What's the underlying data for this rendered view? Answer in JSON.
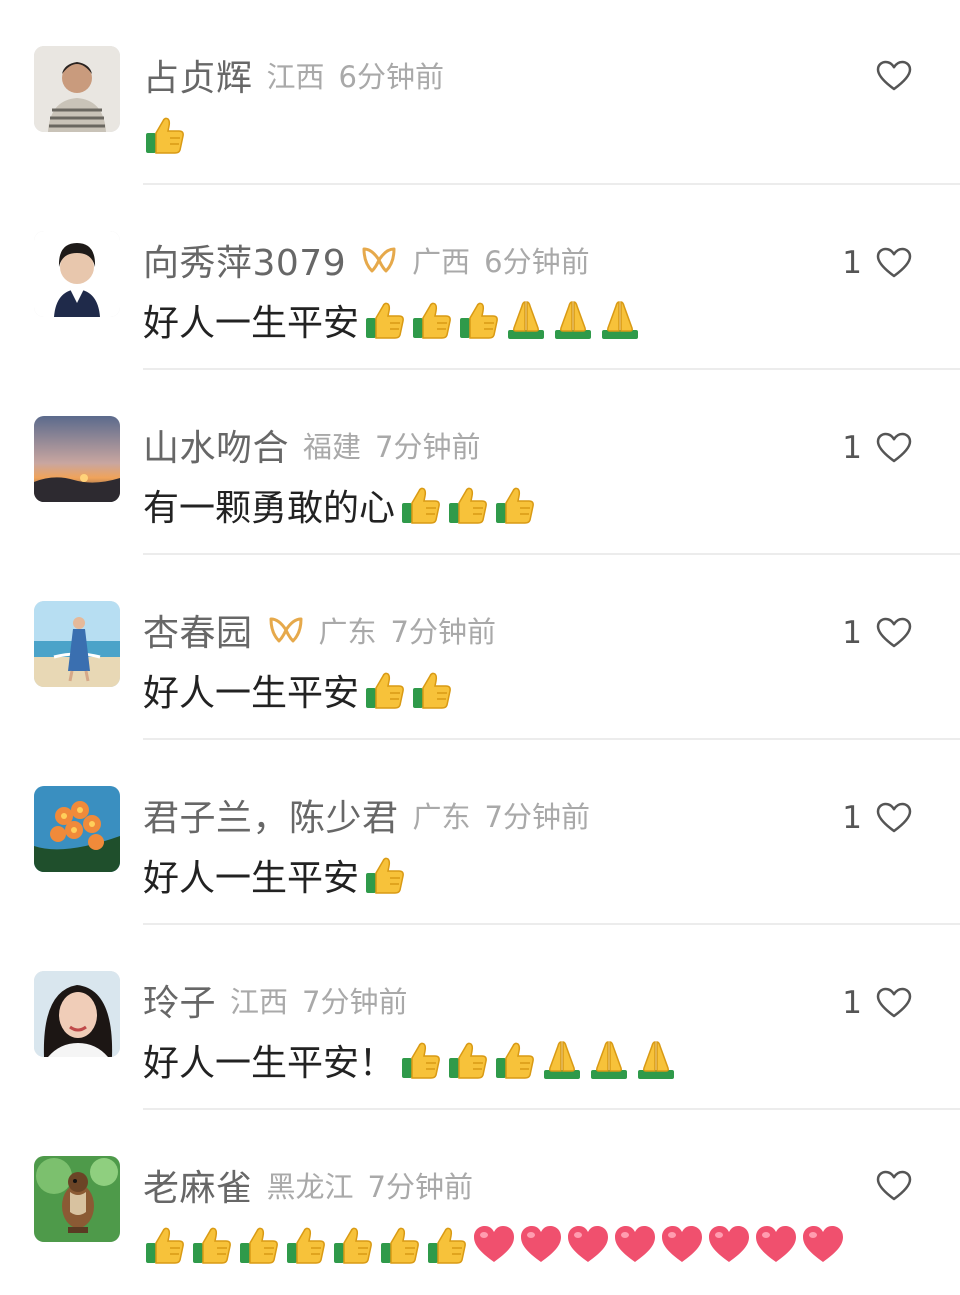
{
  "comments": [
    {
      "username": "占贞辉",
      "badge": false,
      "region": "江西",
      "time": "6分钟前",
      "text": "",
      "emojis": [
        "thumbs-up"
      ],
      "likes": "",
      "avatar": "woman-striped-shirt"
    },
    {
      "username": "向秀萍3079",
      "badge": true,
      "region": "广西",
      "time": "6分钟前",
      "text": "好人一生平安",
      "emojis": [
        "thumbs-up",
        "thumbs-up",
        "thumbs-up",
        "folded-hands",
        "folded-hands",
        "folded-hands"
      ],
      "likes": "1",
      "avatar": "woman-portrait"
    },
    {
      "username": "山水吻合",
      "badge": false,
      "region": "福建",
      "time": "7分钟前",
      "text": "有一颗勇敢的心",
      "emojis": [
        "thumbs-up",
        "thumbs-up",
        "thumbs-up"
      ],
      "likes": "1",
      "avatar": "sunset-landscape"
    },
    {
      "username": "杏春园",
      "badge": true,
      "region": "广东",
      "time": "7分钟前",
      "text": "好人一生平安",
      "emojis": [
        "thumbs-up",
        "thumbs-up"
      ],
      "likes": "1",
      "avatar": "beach-woman"
    },
    {
      "username": "君子兰，陈少君",
      "badge": false,
      "region": "广东",
      "time": "7分钟前",
      "text": "好人一生平安",
      "emojis": [
        "thumbs-up"
      ],
      "likes": "1",
      "avatar": "orange-flowers"
    },
    {
      "username": "玲子",
      "badge": false,
      "region": "江西",
      "time": "7分钟前",
      "text": "好人一生平安！",
      "emojis": [
        "thumbs-up",
        "thumbs-up",
        "thumbs-up",
        "folded-hands",
        "folded-hands",
        "folded-hands"
      ],
      "likes": "1",
      "avatar": "woman-closeup"
    },
    {
      "username": "老麻雀",
      "badge": false,
      "region": "黑龙江",
      "time": "7分钟前",
      "text": "",
      "emojis": [
        "thumbs-up",
        "thumbs-up",
        "thumbs-up",
        "thumbs-up",
        "thumbs-up",
        "thumbs-up",
        "thumbs-up",
        "red-heart",
        "red-heart",
        "red-heart",
        "red-heart",
        "red-heart",
        "red-heart",
        "red-heart",
        "red-heart"
      ],
      "likes": "",
      "avatar": "sparrow-bird"
    }
  ],
  "colors": {
    "username": "#676767",
    "meta": "#a9a9a9",
    "text": "#222222",
    "badge": "#e6a94b",
    "divider": "#ececec"
  }
}
